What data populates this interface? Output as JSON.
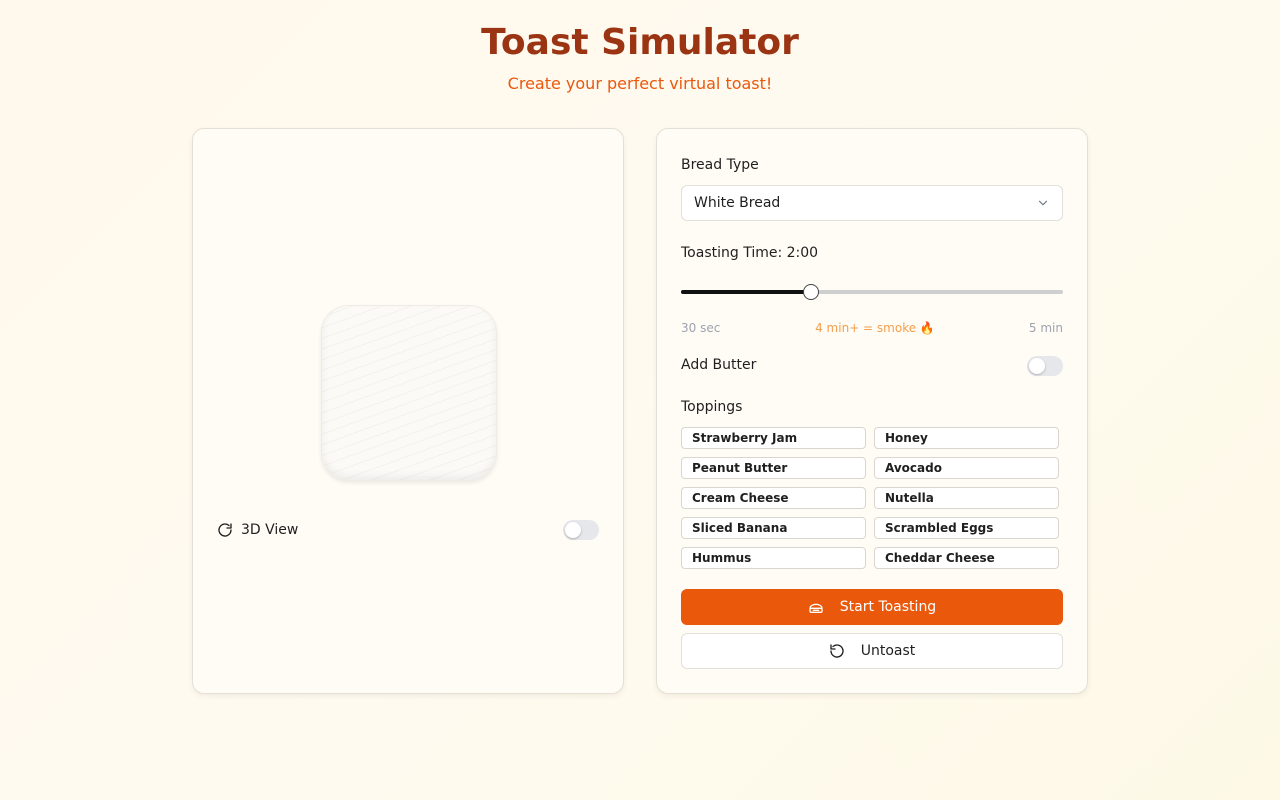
{
  "header": {
    "title": "Toast Simulator",
    "subtitle": "Create your perfect virtual toast!"
  },
  "preview": {
    "view_label": "3D View",
    "view_3d_enabled": false
  },
  "controls": {
    "bread_type_label": "Bread Type",
    "bread_type_value": "White Bread",
    "toasting_time_label": "Toasting Time: 2:00",
    "toasting_time_min_label": "30 sec",
    "toasting_time_warning": "4 min+ = smoke 🔥",
    "toasting_time_max_label": "5 min",
    "toasting_time_fraction": 0.34,
    "butter_label": "Add Butter",
    "butter_enabled": false,
    "toppings_label": "Toppings",
    "toppings": [
      "Strawberry Jam",
      "Honey",
      "Peanut Butter",
      "Avocado",
      "Cream Cheese",
      "Nutella",
      "Sliced Banana",
      "Scrambled Eggs",
      "Hummus",
      "Cheddar Cheese"
    ],
    "start_label": "Start Toasting",
    "untoast_label": "Untoast"
  },
  "colors": {
    "title": "#9a3412",
    "subtitle": "#ea580c",
    "primary_button": "#ea580c",
    "warning_text": "#f59e4b"
  },
  "icons": {
    "view_toggle": "refresh-icon",
    "select_caret": "chevron-down-icon",
    "start": "toaster-icon",
    "untoast": "undo-icon"
  }
}
